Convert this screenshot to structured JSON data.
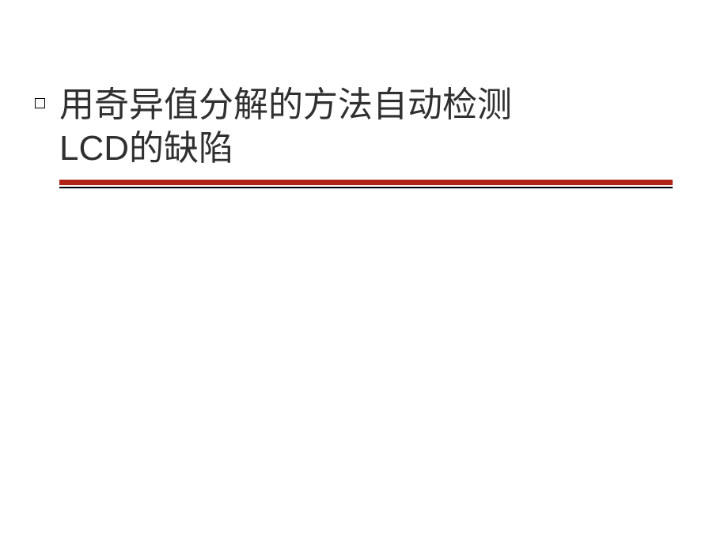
{
  "slide": {
    "title_line_1": "用奇异值分解的方法自动检测",
    "title_line_2": "LCD的缺陷"
  },
  "colors": {
    "accent_line": "#b02418",
    "text": "#303030"
  }
}
